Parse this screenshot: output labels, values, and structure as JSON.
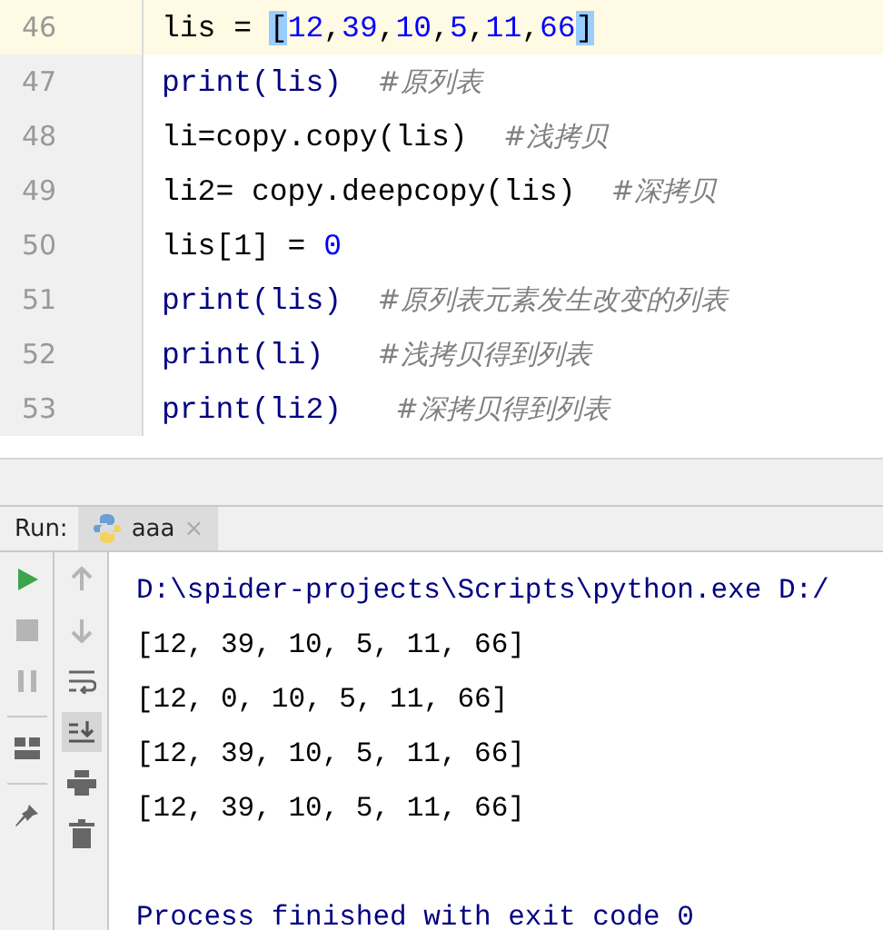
{
  "editor": {
    "lines": [
      {
        "number": "46",
        "current": true,
        "segments": [
          {
            "kind": "code",
            "text": "lis = "
          },
          {
            "kind": "match",
            "text": "["
          },
          {
            "kind": "num",
            "text": "12"
          },
          {
            "kind": "code",
            "text": ","
          },
          {
            "kind": "num",
            "text": "39"
          },
          {
            "kind": "code",
            "text": ","
          },
          {
            "kind": "num",
            "text": "10"
          },
          {
            "kind": "code",
            "text": ","
          },
          {
            "kind": "num",
            "text": "5"
          },
          {
            "kind": "code",
            "text": ","
          },
          {
            "kind": "num",
            "text": "11"
          },
          {
            "kind": "code",
            "text": ","
          },
          {
            "kind": "num",
            "text": "66"
          },
          {
            "kind": "match",
            "text": "]"
          }
        ]
      },
      {
        "number": "47",
        "current": false,
        "segments": [
          {
            "kind": "builtin",
            "text": "print(lis)  "
          },
          {
            "kind": "comment",
            "text": "#原列表"
          }
        ]
      },
      {
        "number": "48",
        "current": false,
        "segments": [
          {
            "kind": "code",
            "text": "li=copy.copy(lis)  "
          },
          {
            "kind": "comment",
            "text": "#浅拷贝"
          }
        ]
      },
      {
        "number": "49",
        "current": false,
        "segments": [
          {
            "kind": "code",
            "text": "li2= copy.deepcopy(lis)  "
          },
          {
            "kind": "comment",
            "text": "#深拷贝"
          }
        ]
      },
      {
        "number": "50",
        "current": false,
        "segments": [
          {
            "kind": "code",
            "text": "lis[1] = "
          },
          {
            "kind": "num",
            "text": "0"
          }
        ]
      },
      {
        "number": "51",
        "current": false,
        "segments": [
          {
            "kind": "builtin",
            "text": "print(lis)  "
          },
          {
            "kind": "comment",
            "text": "#原列表元素发生改变的列表"
          }
        ]
      },
      {
        "number": "52",
        "current": false,
        "segments": [
          {
            "kind": "builtin",
            "text": "print(li)   "
          },
          {
            "kind": "comment",
            "text": "#浅拷贝得到列表"
          }
        ]
      },
      {
        "number": "53",
        "current": false,
        "segments": [
          {
            "kind": "builtin",
            "text": "print(li2)   "
          },
          {
            "kind": "comment",
            "text": "#深拷贝得到列表"
          }
        ]
      }
    ]
  },
  "run_panel": {
    "label": "Run:",
    "tab": {
      "title": "aaa",
      "close": "×"
    },
    "left_tools": [
      {
        "kind": "play",
        "disabled": false
      },
      {
        "kind": "stop",
        "disabled": true
      },
      {
        "kind": "pause",
        "disabled": true
      },
      {
        "kind": "layout"
      },
      {
        "kind": "pin"
      }
    ],
    "right_tools": [
      {
        "kind": "up",
        "selected": false
      },
      {
        "kind": "down",
        "selected": false
      },
      {
        "kind": "wrap",
        "selected": false
      },
      {
        "kind": "scroll-end",
        "selected": true
      },
      {
        "kind": "print",
        "selected": false
      },
      {
        "kind": "trash",
        "selected": false
      }
    ],
    "console": [
      {
        "kind": "system",
        "text": "D:\\spider-projects\\Scripts\\python.exe D:/"
      },
      {
        "kind": "output",
        "text": "[12, 39, 10, 5, 11, 66]"
      },
      {
        "kind": "output",
        "text": "[12, 0, 10, 5, 11, 66]"
      },
      {
        "kind": "output",
        "text": "[12, 39, 10, 5, 11, 66]"
      },
      {
        "kind": "output",
        "text": "[12, 39, 10, 5, 11, 66]"
      },
      {
        "kind": "blank"
      },
      {
        "kind": "system",
        "text": "Process finished with exit code 0"
      }
    ]
  }
}
